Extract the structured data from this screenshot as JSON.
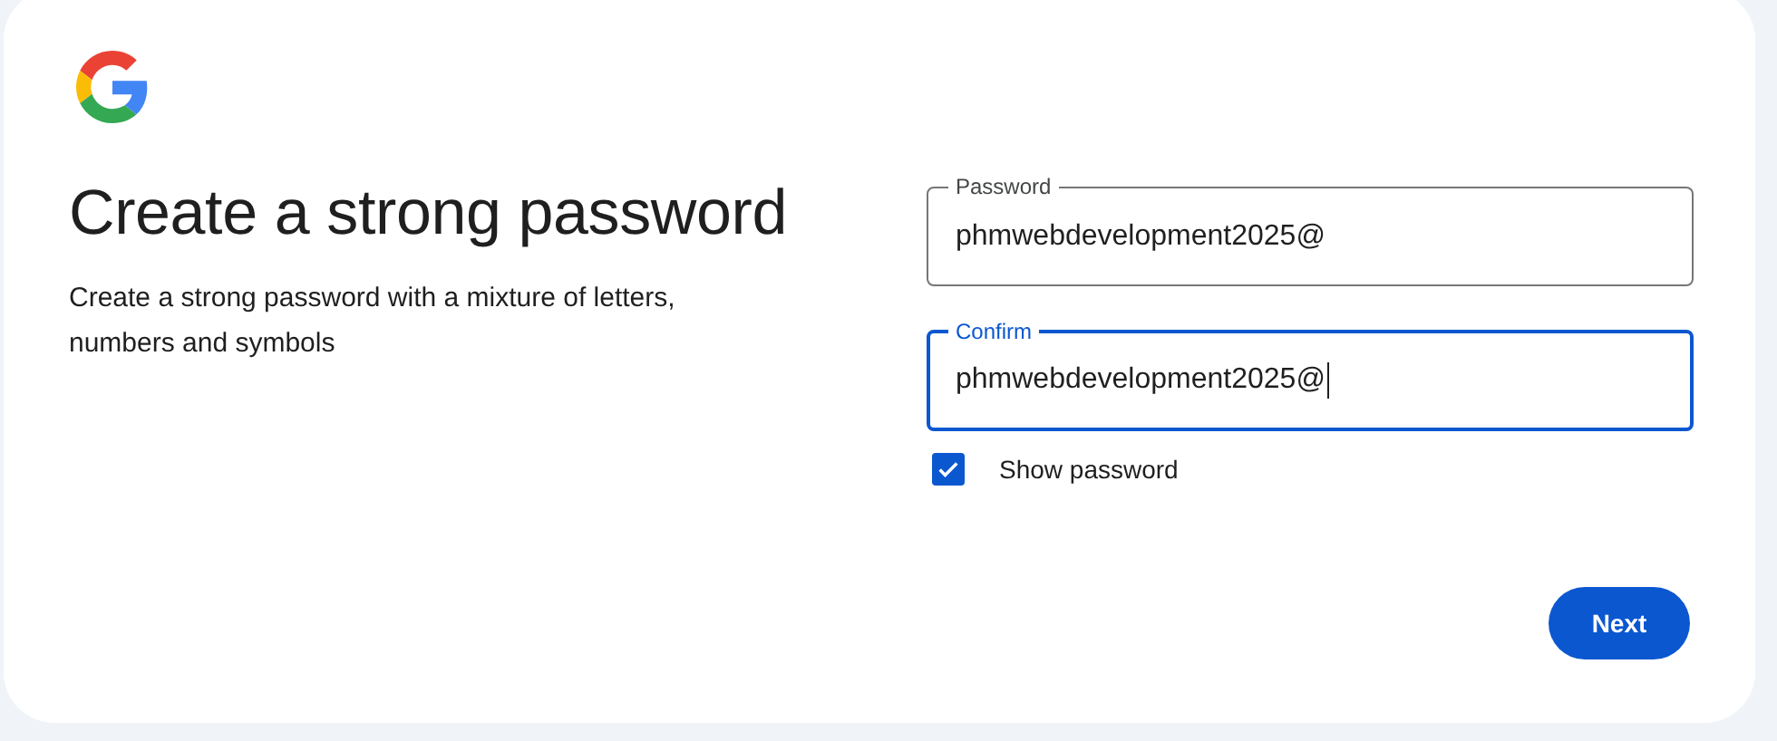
{
  "heading": "Create a strong password",
  "description": "Create a strong password with a mixture of letters, numbers and symbols",
  "fields": [
    {
      "label": "Password",
      "value": "phmwebdevelopment2025@",
      "focused": false
    },
    {
      "label": "Confirm",
      "value": "phmwebdevelopment2025@",
      "focused": true
    }
  ],
  "show_password": {
    "label": "Show password",
    "checked": true
  },
  "buttons": [
    {
      "label": "Next"
    }
  ]
}
